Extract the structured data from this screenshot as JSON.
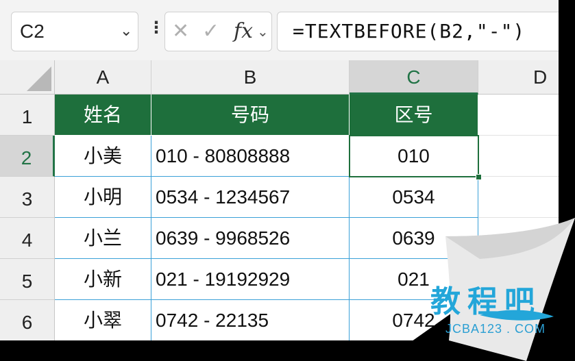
{
  "name_box": {
    "value": "C2",
    "chevron_icon": "chevron-down-icon"
  },
  "formula_bar": {
    "more_icon": "vertical-ellipsis-icon",
    "cancel_icon": "cross-icon",
    "enter_icon": "check-icon",
    "fx_label": "fx",
    "formula": "=TEXTBEFORE(B2,\"-\")"
  },
  "columns": [
    "A",
    "B",
    "C",
    "D"
  ],
  "rows": [
    "1",
    "2",
    "3",
    "4",
    "5",
    "6"
  ],
  "header_row": {
    "a": "姓名",
    "b": "号码",
    "c": "区号"
  },
  "data_rows": [
    {
      "a": "小美",
      "b": "010 - 80808888",
      "c": "010"
    },
    {
      "a": "小明",
      "b": "0534 - 1234567",
      "c": "0534"
    },
    {
      "a": "小兰",
      "b": "0639 - 9968526",
      "c": "0639"
    },
    {
      "a": "小新",
      "b": "021 - 19192929",
      "c": "021"
    },
    {
      "a": "小翠",
      "b": "0742 - 22135",
      "c": "0742"
    }
  ],
  "watermark": {
    "main": "教程吧",
    "sub": "JCBA123 . COM"
  },
  "colors": {
    "accent": "#217346",
    "header_fill": "#1e6f3c",
    "border_blue": "#3aa0d8",
    "watermark": "#23a6d9"
  }
}
